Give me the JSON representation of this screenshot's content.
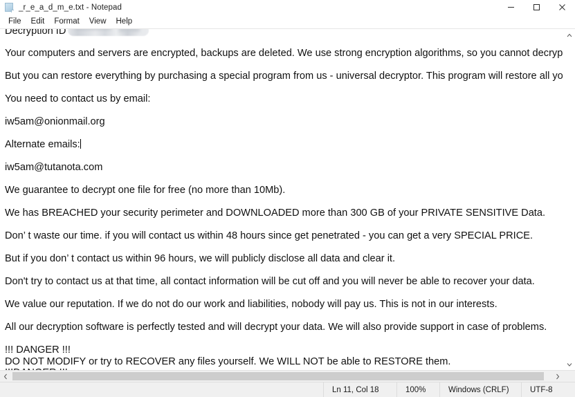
{
  "window": {
    "title": "_r_e_a_d_m_e.txt - Notepad",
    "icon": "notepad-document-icon",
    "controls": {
      "minimize": "minimize-icon",
      "maximize": "maximize-icon",
      "close": "close-icon"
    }
  },
  "menubar": {
    "items": [
      {
        "label": "File"
      },
      {
        "label": "Edit"
      },
      {
        "label": "Format"
      },
      {
        "label": "View"
      },
      {
        "label": "Help"
      }
    ]
  },
  "document": {
    "lines": [
      {
        "text": "Decryption ID",
        "redacted": true
      },
      {
        "text": ""
      },
      {
        "text": "Your computers and servers are encrypted, backups are deleted. We use strong encryption algorithms, so you cannot decrypt your data."
      },
      {
        "text": ""
      },
      {
        "text": "But you can restore everything by purchasing a special program from us - universal decryptor. This program will restore all your network."
      },
      {
        "text": ""
      },
      {
        "text": "You need to contact us by email:"
      },
      {
        "text": ""
      },
      {
        "text": "iw5am@onionmail.org"
      },
      {
        "text": ""
      },
      {
        "text": "Alternate emails:",
        "caret": true
      },
      {
        "text": ""
      },
      {
        "text": "iw5am@tutanota.com"
      },
      {
        "text": ""
      },
      {
        "text": "We guarantee to decrypt one file for free (no more than 10Mb)."
      },
      {
        "text": ""
      },
      {
        "text": "We has BREACHED your security perimeter and DOWNLOADED more than 300 GB of your PRIVATE SENSITIVE Data."
      },
      {
        "text": ""
      },
      {
        "text": "Don’ t waste our time. if you will contact us within 48 hours since get penetrated - you can get a very SPECIAL PRICE."
      },
      {
        "text": ""
      },
      {
        "text": "But if you don’ t contact us within 96 hours, we will publicly disclose all data and clear it."
      },
      {
        "text": ""
      },
      {
        "text": "Don't try to contact us at that time, all contact information will be cut off and you will never be able to recover your data."
      },
      {
        "text": ""
      },
      {
        "text": "We value our reputation. If we do not do our work and liabilities, nobody will pay us. This is not in our interests."
      },
      {
        "text": ""
      },
      {
        "text": "All our decryption software is perfectly tested and will decrypt your data. We will also provide support in case of problems."
      },
      {
        "text": ""
      },
      {
        "text": "!!! DANGER !!!"
      },
      {
        "text": "DO NOT MODIFY or try to RECOVER any files yourself. We WILL NOT be able to RESTORE them."
      },
      {
        "text": "!!!DANGER !!!"
      }
    ]
  },
  "scrollbars": {
    "vertical": {
      "up_arrow": "chevron-up-icon",
      "down_arrow": "chevron-down-icon"
    },
    "horizontal": {
      "left_arrow": "chevron-left-icon",
      "right_arrow": "chevron-right-icon"
    }
  },
  "statusbar": {
    "cursor_position": "Ln 11, Col 18",
    "zoom": "100%",
    "line_endings": "Windows (CRLF)",
    "encoding": "UTF-8"
  },
  "colors": {
    "window_bg": "#ffffff",
    "text": "#111111",
    "statusbar_bg": "#f0f0f0",
    "scrollbar_thumb": "#cdcdcd",
    "close_hover": "#e81123"
  }
}
